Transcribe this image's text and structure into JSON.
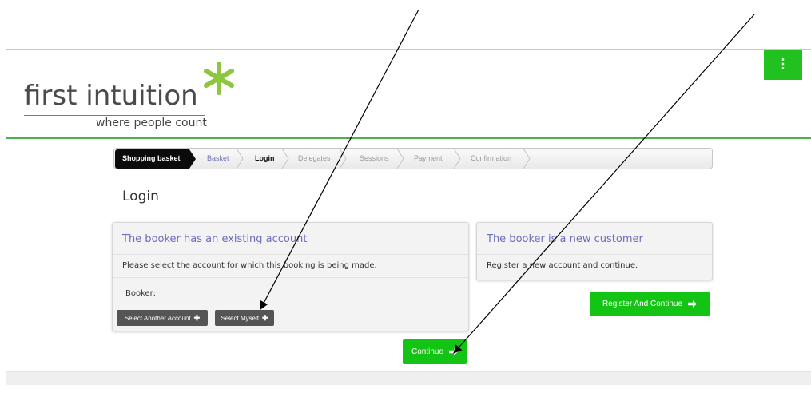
{
  "logo": {
    "main_text": "first intuition",
    "tagline": "where people count",
    "star_color": "#8dc63f"
  },
  "menu": {
    "icon": "vertical-dots-icon",
    "glyph": "⋮"
  },
  "breadcrumb": {
    "first": "Shopping basket",
    "steps": [
      {
        "label": "Basket",
        "state": "visited"
      },
      {
        "label": "Login",
        "state": "active"
      },
      {
        "label": "Delegates",
        "state": "pending"
      },
      {
        "label": "Sessions",
        "state": "pending"
      },
      {
        "label": "Payment",
        "state": "pending"
      },
      {
        "label": "Confirmation",
        "state": "pending"
      }
    ]
  },
  "page": {
    "title": "Login"
  },
  "existing_account": {
    "heading": "The booker has an existing account",
    "instruction": "Please select the account for which this booking is being made.",
    "booker_label": "Booker:",
    "select_another_label": "Select Another Account",
    "select_myself_label": "Select Myself"
  },
  "new_customer": {
    "heading": "The booker is a new customer",
    "instruction": "Register a new account and continue.",
    "register_label": "Register And Continue"
  },
  "actions": {
    "continue_label": "Continue"
  },
  "colors": {
    "accent_green": "#14c414",
    "heading_purple": "#6d6dbf",
    "divider_green": "#4caf50",
    "dark_button": "#555555"
  }
}
